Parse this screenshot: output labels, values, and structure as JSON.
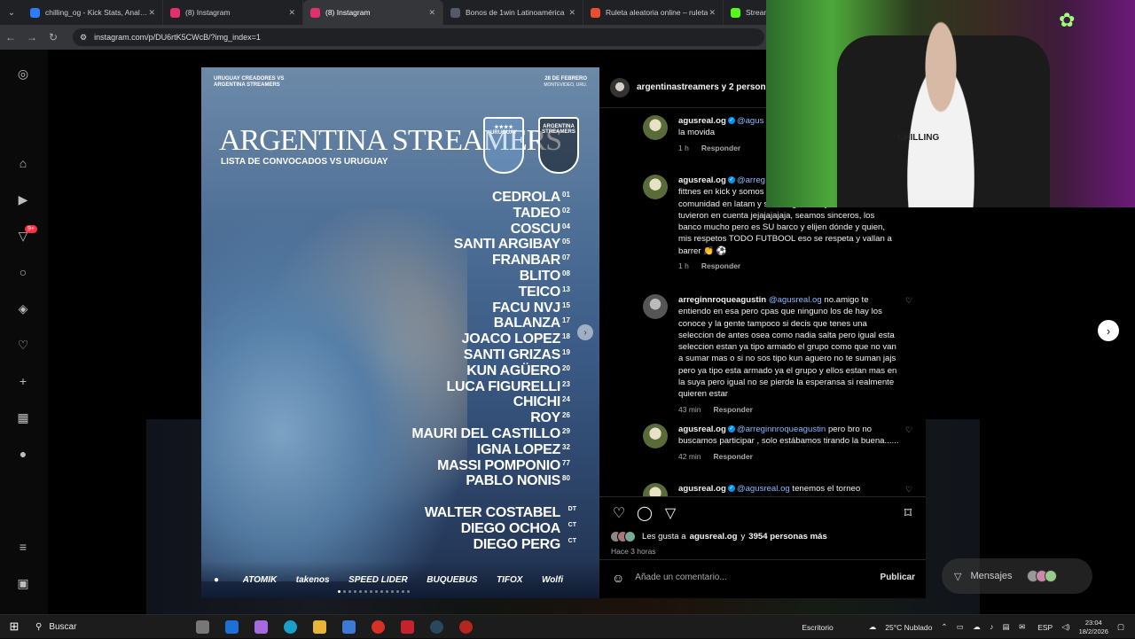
{
  "browser": {
    "tabs": [
      {
        "title": "chilling_og - Kick Stats, Analytic",
        "color": "#2d7cff",
        "active": false
      },
      {
        "title": "(8) Instagram",
        "color": "#e1306c",
        "active": false
      },
      {
        "title": "(8) Instagram",
        "color": "#e1306c",
        "active": true
      },
      {
        "title": "Bonos de 1win Latinoamérica",
        "color": "#555a66",
        "active": false
      },
      {
        "title": "Ruleta aleatoria online – ruleta",
        "color": "#e94f2e",
        "active": false
      },
      {
        "title": "Stream",
        "color": "#53fc18",
        "active": false
      }
    ],
    "url": "instagram.com/p/DU6rtK5CWcB/?img_index=1"
  },
  "post_image": {
    "header_left": "URUGUAY CREADORES VS ARGENTINA STREAMERS",
    "header_date": "28 DE FEBRERO",
    "header_place": "MONTEVIDEO, URU.",
    "title": "ARGENTINA STREAMERS",
    "subtitle": "LISTA DE CONVOCADOS VS URUGUAY",
    "shield_uy": "URUGUAY",
    "shield_ar": "ARGENTINA STREAMERS",
    "players": [
      {
        "name": "CEDROLA",
        "number": "01"
      },
      {
        "name": "TADEO",
        "number": "02"
      },
      {
        "name": "COSCU",
        "number": "04"
      },
      {
        "name": "SANTI ARGIBAY",
        "number": "05"
      },
      {
        "name": "FRANBAR",
        "number": "07"
      },
      {
        "name": "BLITO",
        "number": "08"
      },
      {
        "name": "TEICO",
        "number": "13"
      },
      {
        "name": "FACU NVJ",
        "number": "15"
      },
      {
        "name": "BALANZA",
        "number": "17"
      },
      {
        "name": "JOACO LOPEZ",
        "number": "18"
      },
      {
        "name": "SANTI GRIZAS",
        "number": "19"
      },
      {
        "name": "KUN AGÜERO",
        "number": "20"
      },
      {
        "name": "LUCA FIGURELLI",
        "number": "23"
      },
      {
        "name": "CHICHI",
        "number": "24"
      },
      {
        "name": "ROY",
        "number": "26"
      },
      {
        "name": "MAURI DEL CASTILLO",
        "number": "29"
      },
      {
        "name": "IGNA LOPEZ",
        "number": "32"
      },
      {
        "name": "MASSI POMPONIO",
        "number": "77"
      },
      {
        "name": "PABLO NONIS",
        "number": "80"
      }
    ],
    "staff": [
      {
        "name": "WALTER COSTABEL",
        "role": "DT"
      },
      {
        "name": "DIEGO OCHOA",
        "role": "CT"
      },
      {
        "name": "DIEGO PERG",
        "role": "CT"
      }
    ],
    "sponsors": [
      "ATOMIK",
      "takenos",
      "SPEED LIDER",
      "BUQUEBUS",
      "TIFOX",
      "Wolfi"
    ]
  },
  "panel": {
    "header_name": "argentinastreamers y 2 person",
    "comments": [
      {
        "user": "agusreal.og",
        "mention": "@agus",
        "text": "ofende, mis disculpas mucho toda la movida",
        "time": "1 h",
        "reply": "Responder"
      },
      {
        "user": "agusreal.og",
        "mention": "@arreg",
        "text": "garantizo que está toc global fittnes en kick y somos uno de los canales con más comunidad en latam y straming house y nunca nos tuvieron en cuenta jejajajajaja, seamos sinceros, los banco mucho pero es SU barco y elijen dónde y quien, mis respetos TODO FUTBOOL eso se respeta y vallan a barrer 👏 ⚽",
        "time": "1 h",
        "reply": "Responder"
      },
      {
        "user": "arreginnroqueagustin",
        "mention": "@agusreal.og",
        "text": "no.amigo te entiendo en esa pero cpas que ninguno los de hay los conoce y la gente tampoco si decis que tenes una seleccion de antes osea como nadia salta pero igual esta seleccion estan ya tipo armado el grupo como que no van a sumar mas o si no sos tipo kun aguero no te suman jajs pero ya tipo esta armado ya el grupo y ellos estan mas en la suya pero igual no se pierde la esperansa si realmente quieren estar",
        "time": "43 min",
        "reply": "Responder"
      },
      {
        "user": "agusreal.og",
        "mention": "@arreginnroqueagustin",
        "text": "pero bro no buscamos participar , solo estábamos tirando la buena......",
        "time": "42 min",
        "reply": "Responder"
      },
      {
        "user": "agusreal.og",
        "mention": "@agusreal.og",
        "text": "tenemos el torneo",
        "time": "",
        "reply": ""
      }
    ],
    "likes_prefix": "Les gusta a",
    "likes_user": "agusreal.og",
    "likes_conj": "y",
    "likes_count": "3954 personas más",
    "posted": "Hace 3 horas",
    "comment_placeholder": "Añade un comentario...",
    "publish_label": "Publicar"
  },
  "messages_label": "Mensajes",
  "webcam": {
    "shirt_text": "CHILLING"
  },
  "taskbar": {
    "search_label": "Buscar",
    "desktop_label": "Escritorio",
    "weather": "25°C  Nublado",
    "lang": "ESP",
    "time": "23:04",
    "date": "18/2/2026"
  },
  "rail": {
    "badge": "9+"
  }
}
